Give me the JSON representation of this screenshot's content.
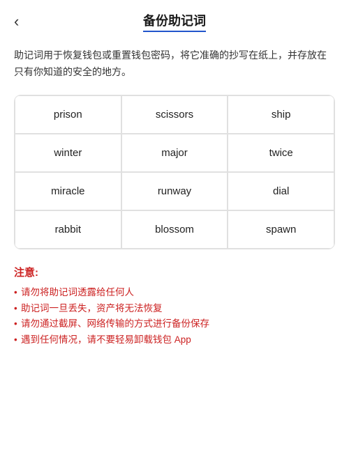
{
  "header": {
    "back_label": "‹",
    "title": "备份助记词"
  },
  "description": "助记词用于恢复钱包或重置钱包密码，将它准确的抄写在纸上，并存放在只有你知道的安全的地方。",
  "grid": {
    "words": [
      "prison",
      "scissors",
      "ship",
      "winter",
      "major",
      "twice",
      "miracle",
      "runway",
      "dial",
      "rabbit",
      "blossom",
      "spawn"
    ]
  },
  "notes": {
    "title": "注意:",
    "items": [
      "请勿将助记词透露给任何人",
      "助记词一旦丢失，资产将无法恢复",
      "请勿通过截屏、网络传输的方式进行备份保存",
      "遇到任何情况，请不要轻易卸载钱包 App"
    ]
  }
}
